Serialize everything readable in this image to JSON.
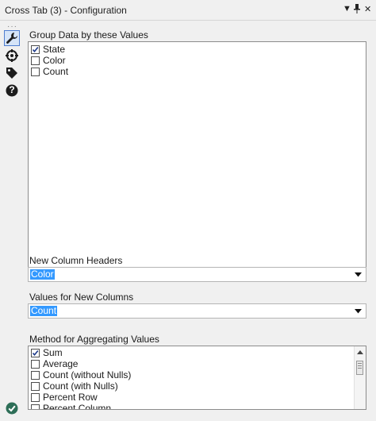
{
  "window": {
    "title": "Cross Tab (3) - Configuration",
    "controls": {
      "dropdown_glyph": "▼",
      "pin_glyph": "📌",
      "close_glyph": "✕"
    }
  },
  "sidebar": {
    "grip": "···",
    "icons": [
      "wrench-icon",
      "crosshair-icon",
      "tag-icon",
      "help-icon"
    ],
    "active_index": 0,
    "help_glyph": "?"
  },
  "group_by": {
    "label": "Group Data by these Values",
    "items": [
      {
        "label": "State",
        "checked": true
      },
      {
        "label": "Color",
        "checked": false
      },
      {
        "label": "Count",
        "checked": false
      }
    ]
  },
  "new_column_headers": {
    "label": "New Column Headers",
    "selected": "Color"
  },
  "values_for_new_columns": {
    "label": "Values for New Columns",
    "selected": "Count"
  },
  "aggregation": {
    "label": "Method for Aggregating Values",
    "items": [
      {
        "label": "Sum",
        "checked": true
      },
      {
        "label": "Average",
        "checked": false
      },
      {
        "label": "Count (without Nulls)",
        "checked": false
      },
      {
        "label": "Count (with Nulls)",
        "checked": false
      },
      {
        "label": "Percent Row",
        "checked": false
      },
      {
        "label": "Percent Column",
        "checked": false
      }
    ]
  },
  "colors": {
    "selection": "#3399ff",
    "active_tab_border": "#4f7ed0",
    "status_ok": "#2d6e57"
  }
}
